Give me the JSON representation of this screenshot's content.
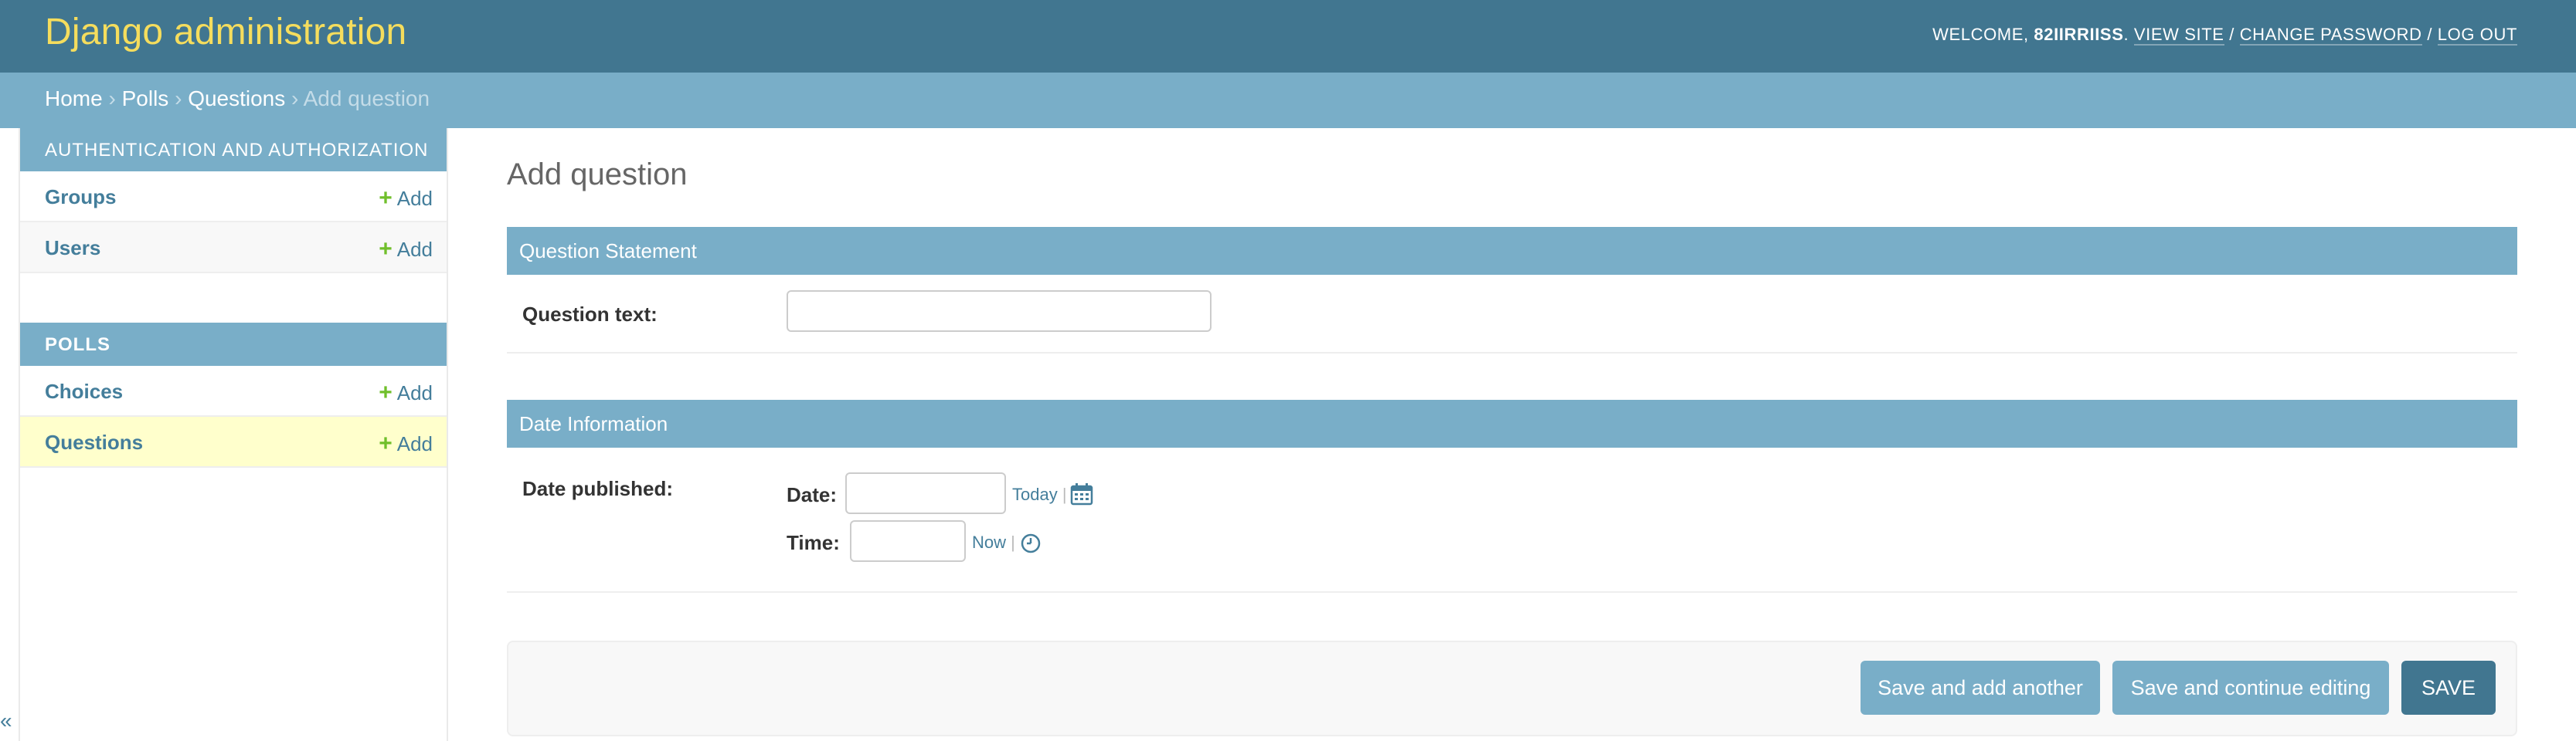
{
  "header": {
    "title": "Django administration",
    "welcome": "WELCOME,",
    "username": "82IIRRIISS",
    "period": ".",
    "view_site": "VIEW SITE",
    "slash1": " / ",
    "change_password": "CHANGE PASSWORD",
    "slash2": " / ",
    "log_out": "LOG OUT"
  },
  "breadcrumbs": {
    "home": "Home",
    "sep": " › ",
    "polls": "Polls",
    "questions": "Questions",
    "current": "Add question"
  },
  "sidebar": {
    "modules": [
      {
        "caption": "AUTHENTICATION AND AUTHORIZATION",
        "rows": [
          {
            "name": "Groups",
            "add": "Add"
          },
          {
            "name": "Users",
            "add": "Add"
          }
        ]
      },
      {
        "caption": "POLLS",
        "rows": [
          {
            "name": "Choices",
            "add": "Add"
          },
          {
            "name": "Questions",
            "add": "Add"
          }
        ]
      }
    ],
    "plus_glyph": "+",
    "collapse_glyph": "«"
  },
  "main": {
    "page_title": "Add question",
    "fieldsets": [
      {
        "title": "Question Statement"
      },
      {
        "title": "Date Information"
      }
    ],
    "question_text_label": "Question text:",
    "question_text_value": "",
    "date_published_label": "Date published:",
    "date_label": "Date:",
    "date_value": "",
    "today": "Today",
    "time_label": "Time:",
    "time_value": "",
    "now": "Now",
    "shortcut_sep": "|",
    "calendar_icon": "calendar-icon",
    "clock_icon": "clock-icon"
  },
  "submit_row": {
    "save_add_another": "Save and add another",
    "save_continue": "Save and continue editing",
    "save": "SAVE"
  },
  "colors": {
    "header_bg": "#417690",
    "brand_text": "#f5dd5d",
    "breadcrumb_bg": "#79aec8",
    "link": "#447e9b",
    "add_green": "#70bf2b",
    "current_row": "#ffffcc"
  }
}
